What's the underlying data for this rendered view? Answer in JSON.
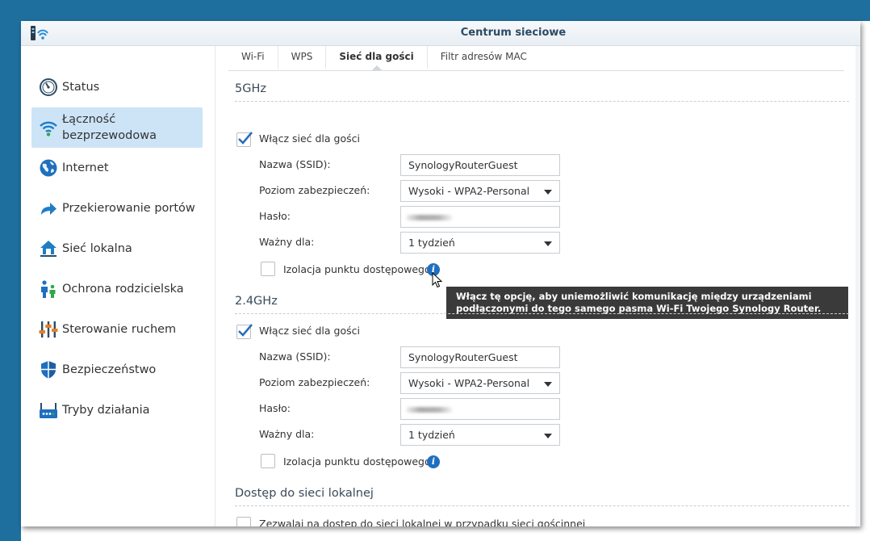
{
  "window": {
    "title": "Centrum sieciowe"
  },
  "sidebar": {
    "items": [
      {
        "label": "Status",
        "icon": "gauge-icon"
      },
      {
        "label": "Łączność bezprzewodowa",
        "icon": "wifi-icon"
      },
      {
        "label": "Internet",
        "icon": "globe-icon"
      },
      {
        "label": "Przekierowanie portów",
        "icon": "arrow-forward-icon"
      },
      {
        "label": "Sieć lokalna",
        "icon": "home-network-icon"
      },
      {
        "label": "Ochrona rodzicielska",
        "icon": "family-icon"
      },
      {
        "label": "Sterowanie ruchem",
        "icon": "sliders-icon"
      },
      {
        "label": "Bezpieczeństwo",
        "icon": "shield-icon"
      },
      {
        "label": "Tryby działania",
        "icon": "router-icon"
      }
    ]
  },
  "tabs": [
    {
      "label": "Wi-Fi"
    },
    {
      "label": "WPS"
    },
    {
      "label": "Sieć dla gości"
    },
    {
      "label": "Filtr adresów MAC"
    }
  ],
  "band5": {
    "title": "5GHz",
    "enable_label": "Włącz sieć dla gości",
    "ssid_label": "Nazwa (SSID):",
    "ssid_value": "SynologyRouterGuest",
    "security_label": "Poziom zabezpieczeń:",
    "security_value": "Wysoki - WPA2-Personal",
    "password_label": "Hasło:",
    "valid_label": "Ważny dla:",
    "valid_value": "1 tydzień",
    "isolation_label": "Izolacja punktu dostępowego"
  },
  "tooltip": {
    "line1": "Włącz tę opcję, aby uniemożliwić komunikację między urządzeniami",
    "line2": "podłączonymi do tego samego pasma Wi-Fi Twojego Synology Router."
  },
  "band24": {
    "title": "2.4GHz",
    "enable_label": "Włącz sieć dla gości",
    "ssid_label": "Nazwa (SSID):",
    "ssid_value": "SynologyRouterGuest",
    "security_label": "Poziom zabezpieczeń:",
    "security_value": "Wysoki - WPA2-Personal",
    "password_label": "Hasło:",
    "valid_label": "Ważny dla:",
    "valid_value": "1 tydzień",
    "isolation_label": "Izolacja punktu dostępowego"
  },
  "lan": {
    "title": "Dostęp do sieci lokalnej",
    "allow_label": "Zezwalaj na dostęp do sieci lokalnej w przypadku sieci gościnnej"
  },
  "colors": {
    "accent": "#1f6fbf",
    "active_nav": "#cde4f7",
    "frame": "#1f6f9e"
  }
}
